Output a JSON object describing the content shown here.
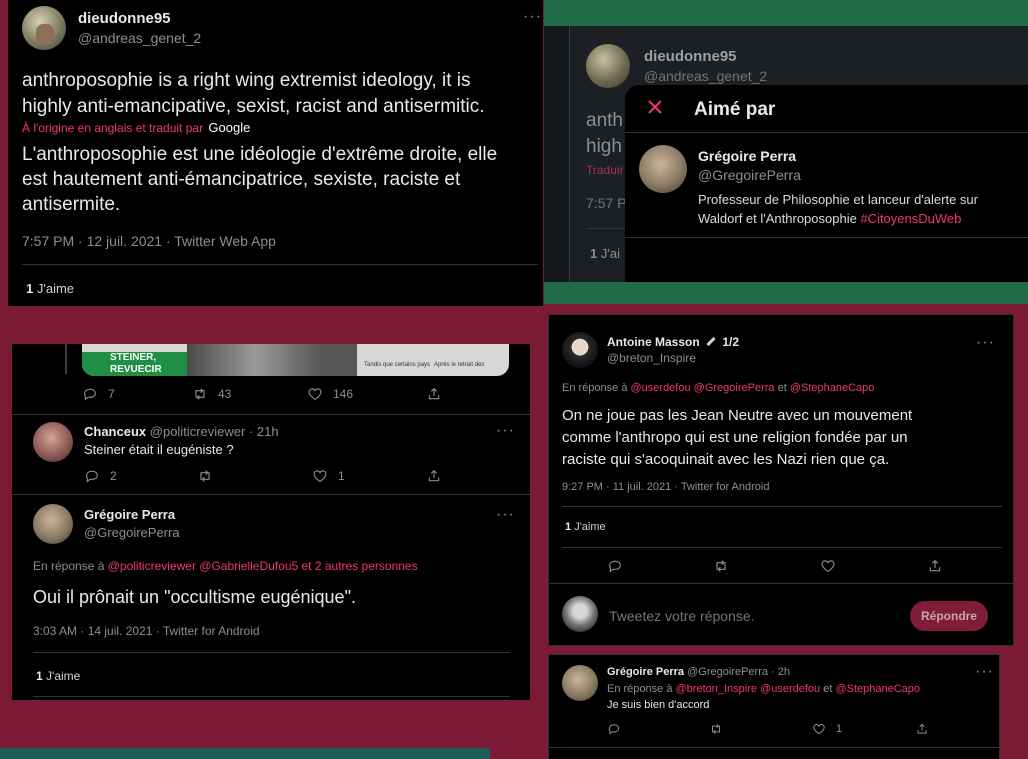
{
  "colors": {
    "background": "#7b1a35",
    "green_bar": "#1f6b4a",
    "pink_accent": "#f0386b",
    "panel": "#000000"
  },
  "tweet_main": {
    "display_name": "dieudonne95",
    "handle": "@andreas_genet_2",
    "text_en_line1": "anthroposophie is a right wing extremist ideology, it is",
    "text_en_line2": "highly anti-emancipative, sexist, racist and antisermitic.",
    "translated_label": "À l'origine en anglais et traduit par",
    "translated_by": "Google",
    "text_fr_line1": "L'anthroposophie est une idéologie d'extrême droite, elle",
    "text_fr_line2": "est hautement anti-émancipatrice, sexiste, raciste et",
    "text_fr_line3": "antisermite.",
    "meta": "7:57 PM · 12 juil. 2021 · Twitter Web App",
    "likes_count": "1",
    "likes_label": "J'aime"
  },
  "tweet_bg": {
    "display_name": "dieudonne95",
    "handle": "@andreas_genet_2",
    "text_part1": "anth",
    "text_part2": "high",
    "translate_part": "Traduir",
    "meta_part": "7:57 P",
    "likes_part": "1",
    "likes_label_part": "J'ai"
  },
  "liked_by_modal": {
    "title": "Aimé par",
    "user_name": "Grégoire Perra",
    "user_handle": "@GregoirePerra",
    "bio_line1": "Professeur de Philosophie et lanceur d'alerte sur",
    "bio_line2_prefix": "Waldorf et l'Anthroposophie",
    "bio_hashtag": "#CitoyensDuWeb"
  },
  "thread_left": {
    "image_caption_top": "STEINER,",
    "image_caption_bottom": "REVUECIR",
    "image_text_a": "Tandis que certains pays",
    "image_text_b": "Après le retrait des",
    "counts": {
      "replies": "7",
      "retweets": "43",
      "likes": "146"
    },
    "reply1": {
      "name": "Chanceux",
      "handle": "@politicreviewer",
      "time": "· 21h",
      "text": "Steiner était il eugéniste ?",
      "replies": "2",
      "likes": "1"
    },
    "reply2": {
      "name": "Grégoire Perra",
      "handle": "@GregoirePerra",
      "in_reply_prefix": "En réponse à",
      "mentions": "@politicreviewer @GabrielleDufou5  et 2 autres personnes",
      "text": "Oui il prônait un \"occultisme eugénique\".",
      "meta": "3:03 AM · 14 juil. 2021 · Twitter for Android",
      "likes_count": "1",
      "likes_label": "J'aime"
    }
  },
  "thread_right": {
    "tweet": {
      "name": "Antoine Masson",
      "badge": "1/2",
      "handle": "@breton_Inspire",
      "in_reply_prefix": "En réponse à",
      "mention1": "@userdefou @GregoirePerra",
      "mention_and": "et",
      "mention2": "@StephaneCapo",
      "text_line1": "On ne joue pas les Jean Neutre avec un mouvement",
      "text_line2": "comme l'anthropo qui est une religion fondée par un",
      "text_line3": "raciste qui s'acoquinait avec les Nazi rien que ça.",
      "meta": "9:27 PM · 11 juil. 2021 · Twitter for Android",
      "likes_count": "1",
      "likes_label": "J'aime"
    },
    "composer": {
      "placeholder": "Tweetez votre réponse.",
      "reply_button": "Répondre"
    },
    "reply": {
      "name": "Grégoire Perra",
      "handle_time": "@GregoirePerra · 2h",
      "in_reply_prefix": "En réponse à",
      "mention1": "@breton_Inspire @userdefou",
      "mention_and": "et",
      "mention2": "@StephaneCapo",
      "text": "Je suis bien d'accord",
      "likes": "1"
    }
  }
}
